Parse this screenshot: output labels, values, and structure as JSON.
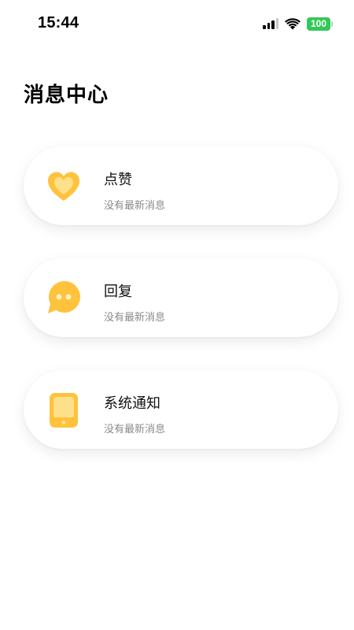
{
  "status_bar": {
    "time": "15:44",
    "battery_level": "100",
    "icons": [
      "cellular-signal-icon",
      "wifi-icon",
      "battery-icon"
    ]
  },
  "page": {
    "title": "消息中心"
  },
  "messages": [
    {
      "title": "点赞",
      "subtitle": "没有最新消息",
      "icon": "heart-icon"
    },
    {
      "title": "回复",
      "subtitle": "没有最新消息",
      "icon": "chat-bubble-icon"
    },
    {
      "title": "系统通知",
      "subtitle": "没有最新消息",
      "icon": "phone-icon"
    }
  ],
  "colors": {
    "accent": "#FFC23C",
    "accent_light": "#FFE08A",
    "battery": "#34C759",
    "subtitle": "#8A8A8A"
  }
}
